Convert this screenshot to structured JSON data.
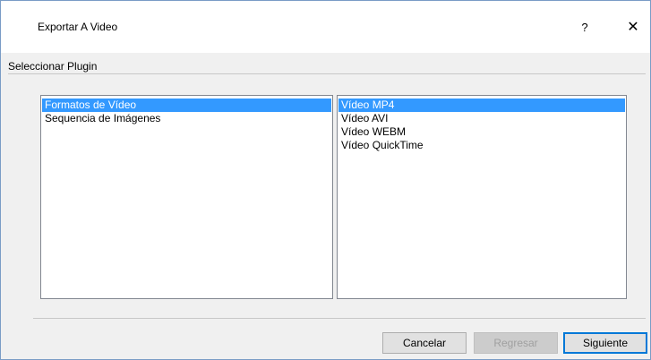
{
  "window": {
    "title": "Exportar A Video",
    "help_glyph": "?",
    "close_glyph": "✕"
  },
  "section": {
    "label": "Seleccionar Plugin"
  },
  "plugin_categories": {
    "items": [
      {
        "label": "Formatos de Vídeo",
        "selected": true
      },
      {
        "label": "Sequencia de Imágenes",
        "selected": false
      }
    ]
  },
  "plugin_formats": {
    "items": [
      {
        "label": "Vídeo MP4",
        "selected": true
      },
      {
        "label": "Vídeo AVI",
        "selected": false
      },
      {
        "label": "Vídeo WEBM",
        "selected": false
      },
      {
        "label": "Vídeo QuickTime",
        "selected": false
      }
    ]
  },
  "buttons": {
    "cancel": "Cancelar",
    "back": "Regresar",
    "next": "Siguiente"
  },
  "colors": {
    "selection": "#3399ff",
    "default_button_border": "#0078d7",
    "window_border": "#7a9cc6"
  }
}
